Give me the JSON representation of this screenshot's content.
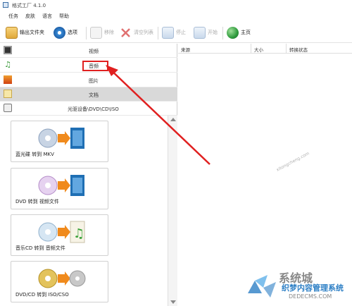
{
  "window": {
    "title": "格式工厂 4.1.0"
  },
  "menu": {
    "items": [
      "任务",
      "皮肤",
      "语言",
      "帮助"
    ]
  },
  "toolbar": {
    "output_folder": "输出文件夹",
    "options": "选项",
    "remove": "移除",
    "clear_list": "清空列表",
    "stop": "停止",
    "start": "开始",
    "home": "主页"
  },
  "categories": {
    "video": "视频",
    "audio": "音频",
    "image": "图片",
    "document": "文档",
    "rom": "光驱设备\\DVD\\CD\\ISO"
  },
  "task_columns": {
    "source": "来源",
    "size": "大小",
    "status": "转换状态"
  },
  "functions": [
    {
      "label": "蓝光碟 转到 MKV"
    },
    {
      "label": "DVD 转到 视频文件"
    },
    {
      "label": "音乐CD 转到 音频文件"
    },
    {
      "label": "DVD/CD 转到 ISO/CSO"
    }
  ],
  "watermark": {
    "site": "xitongcheng.com",
    "brand": "系统城",
    "cms": "织梦内容管理系统",
    "domain": "DEDECMS.COM"
  },
  "colors": {
    "highlight": "#e02020",
    "selected_row": "#d9d9d9"
  }
}
